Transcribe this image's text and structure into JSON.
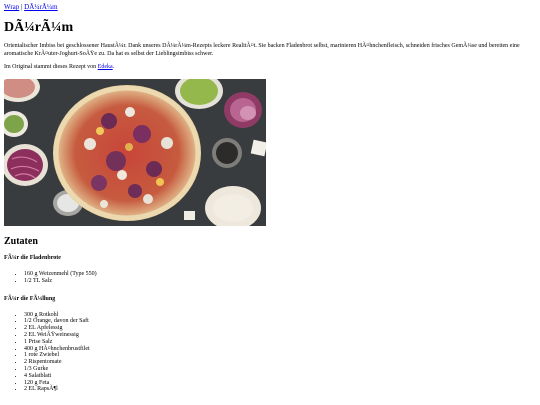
{
  "breadcrumb": {
    "home": "Wrap",
    "separator": "|",
    "current": "DÃ¼rÃ¼m"
  },
  "title": "DÃ¼rÃ¼m",
  "intro": "Orientalischer Imbiss bei geschlossener HaustÃ¼r. Dank unseres DÃ¼rÃ¼m-Rezepts leckere RealitÃ¤t. Sie backen Fladenbrot selbst, marinieren HÃ¤hnchenfleisch, schneiden frisches GemÃ¼se und bereiten eine aromatische KrÃ¤uter-Joghurt-SoÃŸe zu. Da hat es selbst der Lieblingsimbiss schwer.",
  "source": {
    "prefix": "Im Original stammt dieses Rezept von",
    "link": "Edeka",
    "suffix": "."
  },
  "ingredients": {
    "heading": "Zutaten",
    "groups": [
      {
        "title": "FÃ¼r die Fladenbrote",
        "items": [
          "160 g Weizenmehl (Type 550)",
          "1/2 TL Salz"
        ]
      },
      {
        "title": "FÃ¼r die FÃ¼llung",
        "items": [
          "300 g Rotkohl",
          "1/2 Orange, davon der Saft",
          "2 EL Apfelessig",
          "2 EL WeiÃŸweinessig",
          "1 Prise Salz",
          "400 g HÃ¤hnchenbrustfilet",
          "1 rote Zwiebel",
          "2 Rispentomate",
          "1/3 Gurke",
          "4 Salatblatt",
          "120 g Feta",
          "2 EL RapsÃ¶l"
        ]
      }
    ]
  }
}
